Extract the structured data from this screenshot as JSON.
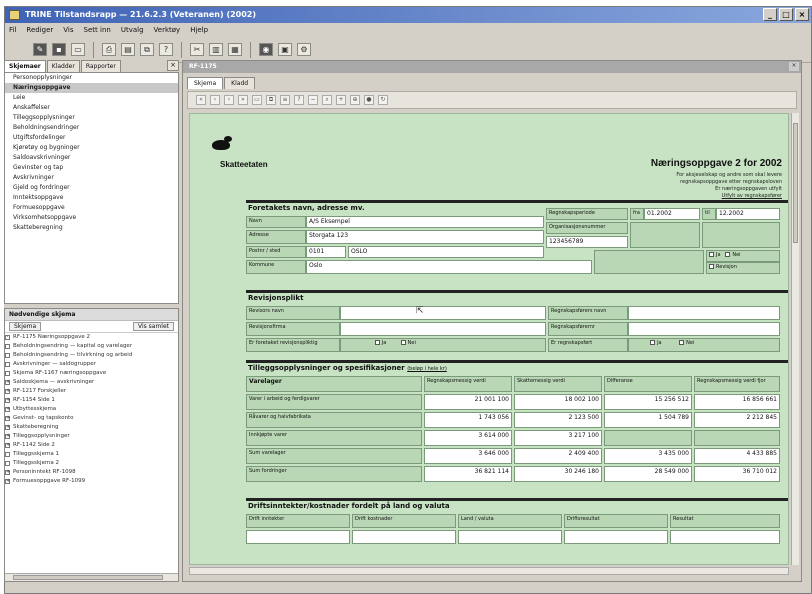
{
  "window": {
    "title": "TRINE Tilstandsrapp — 21.6.2.3 (Veteranen) (2002)",
    "min": "_",
    "max": "□",
    "close": "×"
  },
  "menu": [
    "Fil",
    "Rediger",
    "Vis",
    "Sett inn",
    "Utvalg",
    "Verktøy",
    "Hjelp"
  ],
  "left": {
    "tabs": [
      "Skjemaer",
      "Kladder",
      "Rapporter"
    ],
    "close": "×",
    "nav_items": [
      "Personopplysninger",
      "Næringsoppgave",
      "Leie",
      "Anskaffelser",
      "Tilleggsopplysninger",
      "Beholdningsendringer",
      "Utgiftsfordelinger",
      "Kjøretøy og bygninger",
      "Saldoavskrivninger",
      "Gevinster og tap",
      "Avskrivninger",
      "Gjeld og fordringer",
      "Inntektsoppgave",
      "Formuesoppgave",
      "Virksomhetsoppgave",
      "Skatteberegning"
    ],
    "selected_index": 1,
    "tasks_title": "Nødvendige skjema",
    "tasks_left": "Skjema",
    "tasks_right": "Vis samlet",
    "tasks": [
      "RF-1175 Næringsoppgave 2",
      "Beholdningsendring — kapital og varelager",
      "Beholdningsendring — tilvirkning og arbeid",
      "Avskrivninger — saldogrupper",
      "Skjema RF-1167 næringsoppgave",
      "Saldoskjema — avskrivninger",
      "RF-1217 Forskjeller",
      "RF-1154 Side 1",
      "Utbyttesskjema",
      "Gevinst- og tapskonto",
      "Skatteberegning",
      "Tilleggsopplysninger",
      "RF-1142 Side 2",
      "Tilleggsskjema 1",
      "Tilleggsskjema 2",
      "Personinntekt RF-1098",
      "Formuesoppgave RF-1099"
    ]
  },
  "doc": {
    "title": "RF-1175",
    "tabs": [
      "Skjema",
      "Kladd"
    ],
    "close": "×",
    "authority": "Skatteetaten",
    "form_title": "Næringsoppgave 2 for 2002",
    "sublines": [
      "For aksjeselskap og andre som skal levere",
      "regnskapsoppgave etter regnskapsloven",
      "Er næringsoppgaven utfylt",
      "Utfylt av regnskapsfører"
    ],
    "identity": {
      "header": "Foretakets navn, adresse mv.",
      "name_label": "Navn",
      "name_value": "A/S Eksempel",
      "address_label": "Adresse",
      "address_value": "Storgata 123",
      "postal_label": "Postnr / sted",
      "postnr": "0101",
      "poststed": "OSLO",
      "municipality_label": "Kommune",
      "municipality_value": "Oslo",
      "period_label": "Regnskapsperiode",
      "period_from_label": "fra",
      "period_from": "01.2002",
      "period_to_label": "til",
      "period_to": "12.2002",
      "orgnr_label": "Organisasjonsnummer",
      "orgnr_value": "123456789",
      "checkbox_label_1": "Ja",
      "checkbox_label_2": "Nei",
      "checkbox_label_3": "Revisjon"
    },
    "auditor": {
      "header": "Revisjonsplikt",
      "row1_label": "Revisors navn",
      "row2_label": "Revisjonsfirma",
      "row3_label": "Er foretaket revisjonspliktig",
      "right1_label": "Regnskapsførers navn",
      "right2_label": "Regnskapsførernr",
      "right3_label": "Er regnskapsført",
      "yes": "Ja",
      "no": "Nei"
    },
    "table": {
      "header": "Tilleggsopplysninger og spesifikasjoner",
      "header_note": "(beløp i hele kr)",
      "cols": [
        "Varelager",
        "Regnskapsmessig verdi",
        "Skattemessig verdi",
        "Differanse",
        "Regnskapsmessig verdi fjor"
      ],
      "rows": [
        {
          "label": "Varer i arbeid og ferdigvarer",
          "values": [
            "21 001 100",
            "18 002 100",
            "15 256 512",
            "16 856 661"
          ]
        },
        {
          "label": "Råvarer og halvfabrikata",
          "values": [
            "1 743 056",
            "2 123 500",
            "1 504 789",
            "2 212 845"
          ]
        },
        {
          "label": "Innkjøpte varer",
          "values": [
            "3 614 000",
            "3 217 100",
            "",
            ""
          ]
        },
        {
          "label": "Sum varelager",
          "values": [
            "3 646 000",
            "2 409 400",
            "3 435 000",
            "4 433 885"
          ]
        },
        {
          "label": "Sum fordringer",
          "values": [
            "36 821 114",
            "30 246 180",
            "28 549 000",
            "36 710 012"
          ]
        }
      ]
    },
    "bottom": {
      "header": "Driftsinntekter/kostnader fordelt på land og valuta",
      "cols": [
        "Drift inntekter",
        "Drift kostnader",
        "Land / valuta",
        "Driftsresultat",
        "Resultat"
      ]
    }
  }
}
